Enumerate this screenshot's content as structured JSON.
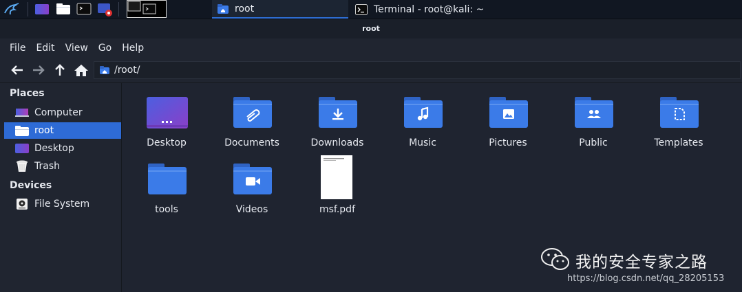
{
  "taskbar": {
    "tasks": [
      {
        "label": "root"
      },
      {
        "label": "Terminal - root@kali: ~"
      }
    ]
  },
  "window": {
    "title": "root"
  },
  "menubar": {
    "items": [
      "File",
      "Edit",
      "View",
      "Go",
      "Help"
    ]
  },
  "location": {
    "path": "/root/"
  },
  "sidebar": {
    "places_heading": "Places",
    "places": [
      {
        "label": "Computer",
        "icon": "computer-icon"
      },
      {
        "label": "root",
        "icon": "home-folder-icon",
        "active": true
      },
      {
        "label": "Desktop",
        "icon": "desktop-icon"
      },
      {
        "label": "Trash",
        "icon": "trash-icon"
      }
    ],
    "devices_heading": "Devices",
    "devices": [
      {
        "label": "File System",
        "icon": "drive-icon"
      }
    ]
  },
  "files": [
    {
      "name": "Desktop",
      "icon": "desktop-folder-icon"
    },
    {
      "name": "Documents",
      "icon": "documents-folder-icon"
    },
    {
      "name": "Downloads",
      "icon": "downloads-folder-icon"
    },
    {
      "name": "Music",
      "icon": "music-folder-icon"
    },
    {
      "name": "Pictures",
      "icon": "pictures-folder-icon"
    },
    {
      "name": "Public",
      "icon": "public-folder-icon"
    },
    {
      "name": "Templates",
      "icon": "templates-folder-icon"
    },
    {
      "name": "tools",
      "icon": "folder-icon"
    },
    {
      "name": "Videos",
      "icon": "videos-folder-icon"
    },
    {
      "name": "msf.pdf",
      "icon": "pdf-file-icon"
    }
  ],
  "watermark": {
    "title": "我的安全专家之路",
    "url": "https://blog.csdn.net/qq_28205153"
  },
  "colors": {
    "folder": "#3b7be8",
    "folder_tab": "#2f63c4",
    "selection": "#2e6bd6",
    "background": "#202530"
  }
}
